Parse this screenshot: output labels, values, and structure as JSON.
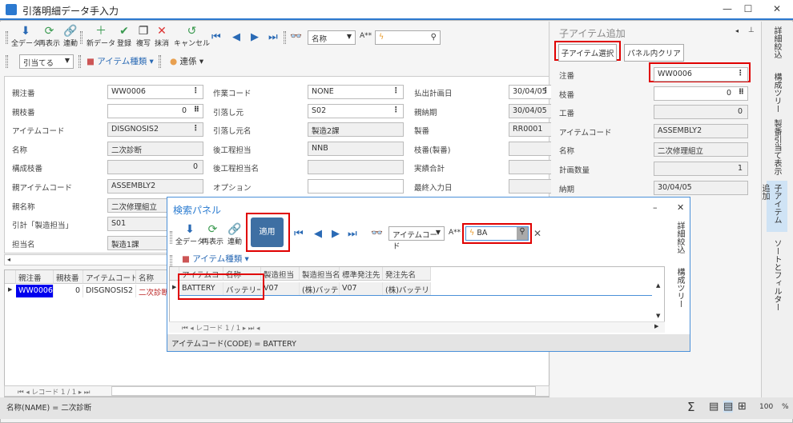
{
  "window": {
    "title": "引落明細データ手入力",
    "minimize": "—",
    "maximize": "☐",
    "close": "✕"
  },
  "toolbar": {
    "all_data": "全データ",
    "refresh": "再表示",
    "link": "連動",
    "new": "新データ",
    "register": "登録",
    "copy": "複写",
    "delete": "抹消",
    "cancel": "キャンセル",
    "search_field": "名称",
    "search_value": "",
    "assign": "引当てる",
    "item_type": "アイテム種類",
    "relation": "連係"
  },
  "form": {
    "rows": [
      [
        {
          "label": "親注番",
          "value": "WW0006"
        },
        {
          "label": "作業コード",
          "value": "NONE"
        },
        {
          "label": "払出計画日",
          "value": "30/04/05"
        }
      ],
      [
        {
          "label": "親枝番",
          "value": "0"
        },
        {
          "label": "引落し元",
          "value": "S02"
        },
        {
          "label": "親納期",
          "value": "30/04/05"
        }
      ],
      [
        {
          "label": "アイテムコード",
          "value": "DISGNOSIS2"
        },
        {
          "label": "引落し元名",
          "value": "製造2課"
        },
        {
          "label": "製番",
          "value": "RR0001"
        }
      ],
      [
        {
          "label": "名称",
          "value": "二次診断"
        },
        {
          "label": "後工程担当",
          "value": "NNB"
        },
        {
          "label": "枝番(製番)",
          "value": ""
        }
      ],
      [
        {
          "label": "構成枝番",
          "value": "0"
        },
        {
          "label": "後工程担当名",
          "value": ""
        },
        {
          "label": "実績合計",
          "value": ""
        }
      ],
      [
        {
          "label": "親アイテムコード",
          "value": "ASSEMBLY2"
        },
        {
          "label": "オプション",
          "value": ""
        },
        {
          "label": "最終入力日",
          "value": ""
        }
      ],
      [
        {
          "label": "親名称",
          "value": "二次修理組立"
        }
      ],
      [
        {
          "label": "引計「製造担当」",
          "value": "S01"
        }
      ],
      [
        {
          "label": "担当名",
          "value": "製造1課"
        }
      ]
    ]
  },
  "grid": {
    "headers": [
      "親注番",
      "親枝番",
      "アイテムコード",
      "名称"
    ],
    "rows": [
      [
        "WW0006",
        "0",
        "DISGNOSIS2",
        "二次診断"
      ]
    ],
    "record": "レコード 1 / 1"
  },
  "status": {
    "text": "名称(NAME) = 二次診断",
    "zoom": "100",
    "percent": "%",
    "sigma": "Σ"
  },
  "right_panel": {
    "title": "子アイテム追加",
    "select_button": "子アイテム選択",
    "clear_button": "パネル内クリア",
    "fields": [
      {
        "label": "注番",
        "value": "WW0006"
      },
      {
        "label": "枝番",
        "value": "0"
      },
      {
        "label": "工番",
        "value": "0"
      },
      {
        "label": "アイテムコード",
        "value": "ASSEMBLY2"
      },
      {
        "label": "名称",
        "value": "二次修理組立"
      },
      {
        "label": "計画数量",
        "value": "1"
      },
      {
        "label": "納期",
        "value": "30/04/05"
      }
    ]
  },
  "side_tabs": [
    "詳細絞込",
    "構成ツリー",
    "製番引当て表示",
    "子アイテム追加",
    "ソートとフィルター"
  ],
  "search_panel": {
    "title": "検索パネル",
    "all_data": "全データ",
    "refresh": "再表示",
    "link": "連動",
    "apply": "適用",
    "field": "アイテムコード",
    "value": "BA",
    "item_type": "アイテム種類",
    "headers": [
      "アイテムコード",
      "名称",
      "製造担当",
      "製造担当名",
      "標準発注先",
      "発注先名"
    ],
    "rows": [
      [
        "BATTERY",
        "バッテリー",
        "V07",
        "(株)バッテリ",
        "V07",
        "(株)バッテリ"
      ]
    ],
    "record": "レコード 1 / 1",
    "status": "アイテムコード(CODE) = BATTERY",
    "tabs": [
      "詳細絞込",
      "構成ツリー"
    ],
    "minimize": "–",
    "close": "✕"
  },
  "colors": {
    "accent": "#2b79d0",
    "highlight": "#e00000",
    "apply_bg": "#3e6fa3",
    "selected_cell": "#0000ee"
  }
}
